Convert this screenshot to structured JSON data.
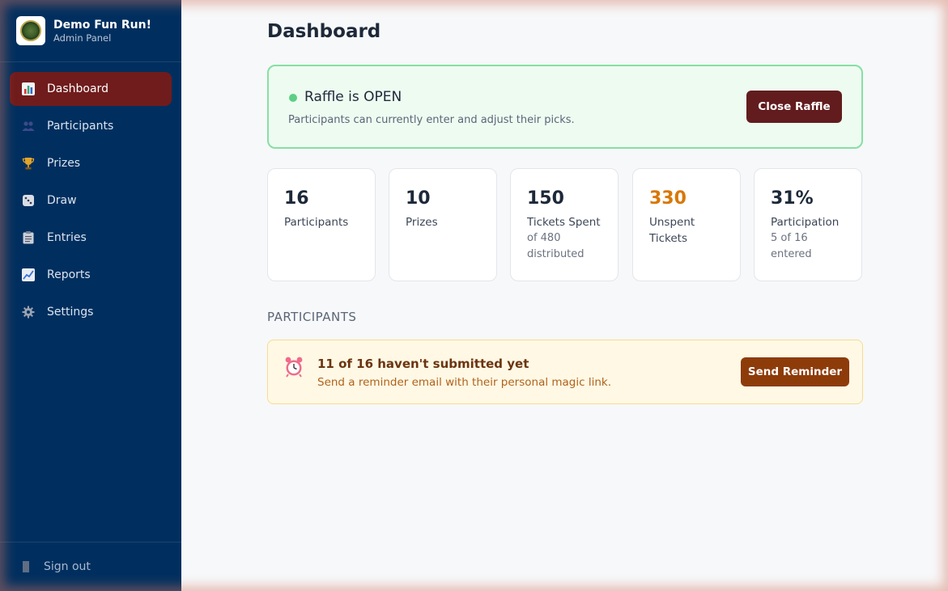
{
  "app": {
    "name": "Demo Fun Run!",
    "subtitle": "Admin Panel"
  },
  "sidebar": {
    "items": [
      {
        "label": "Dashboard",
        "icon": "bar-chart-icon",
        "active": true
      },
      {
        "label": "Participants",
        "icon": "people-icon",
        "active": false
      },
      {
        "label": "Prizes",
        "icon": "trophy-icon",
        "active": false
      },
      {
        "label": "Draw",
        "icon": "dice-icon",
        "active": false
      },
      {
        "label": "Entries",
        "icon": "clipboard-icon",
        "active": false
      },
      {
        "label": "Reports",
        "icon": "line-chart-icon",
        "active": false
      },
      {
        "label": "Settings",
        "icon": "gear-icon",
        "active": false
      }
    ],
    "signout_label": "Sign out"
  },
  "page": {
    "title": "Dashboard"
  },
  "raffle": {
    "status": "Raffle is OPEN",
    "description": "Participants can currently enter and adjust their picks.",
    "button_label": "Close Raffle"
  },
  "stats": [
    {
      "value": "16",
      "label": "Participants",
      "sub": ""
    },
    {
      "value": "10",
      "label": "Prizes",
      "sub": ""
    },
    {
      "value": "150",
      "label": "Tickets Spent",
      "sub": "of 480 distributed"
    },
    {
      "value": "330",
      "label": "Unspent Tickets",
      "sub": ""
    },
    {
      "value": "31%",
      "label": "Participation",
      "sub": "5 of 16 entered"
    }
  ],
  "participants_section": {
    "title": "PARTICIPANTS",
    "reminder_title": "11 of 16 haven't submitted yet",
    "reminder_desc": "Send a reminder email with their personal magic link.",
    "button_label": "Send Reminder"
  },
  "colors": {
    "sidebar_bg": "#002f5f",
    "active_nav": "#701c1c",
    "open_status": "#5ccf84",
    "warning_value": "#d97706",
    "remind_button": "#8e3b0a"
  }
}
